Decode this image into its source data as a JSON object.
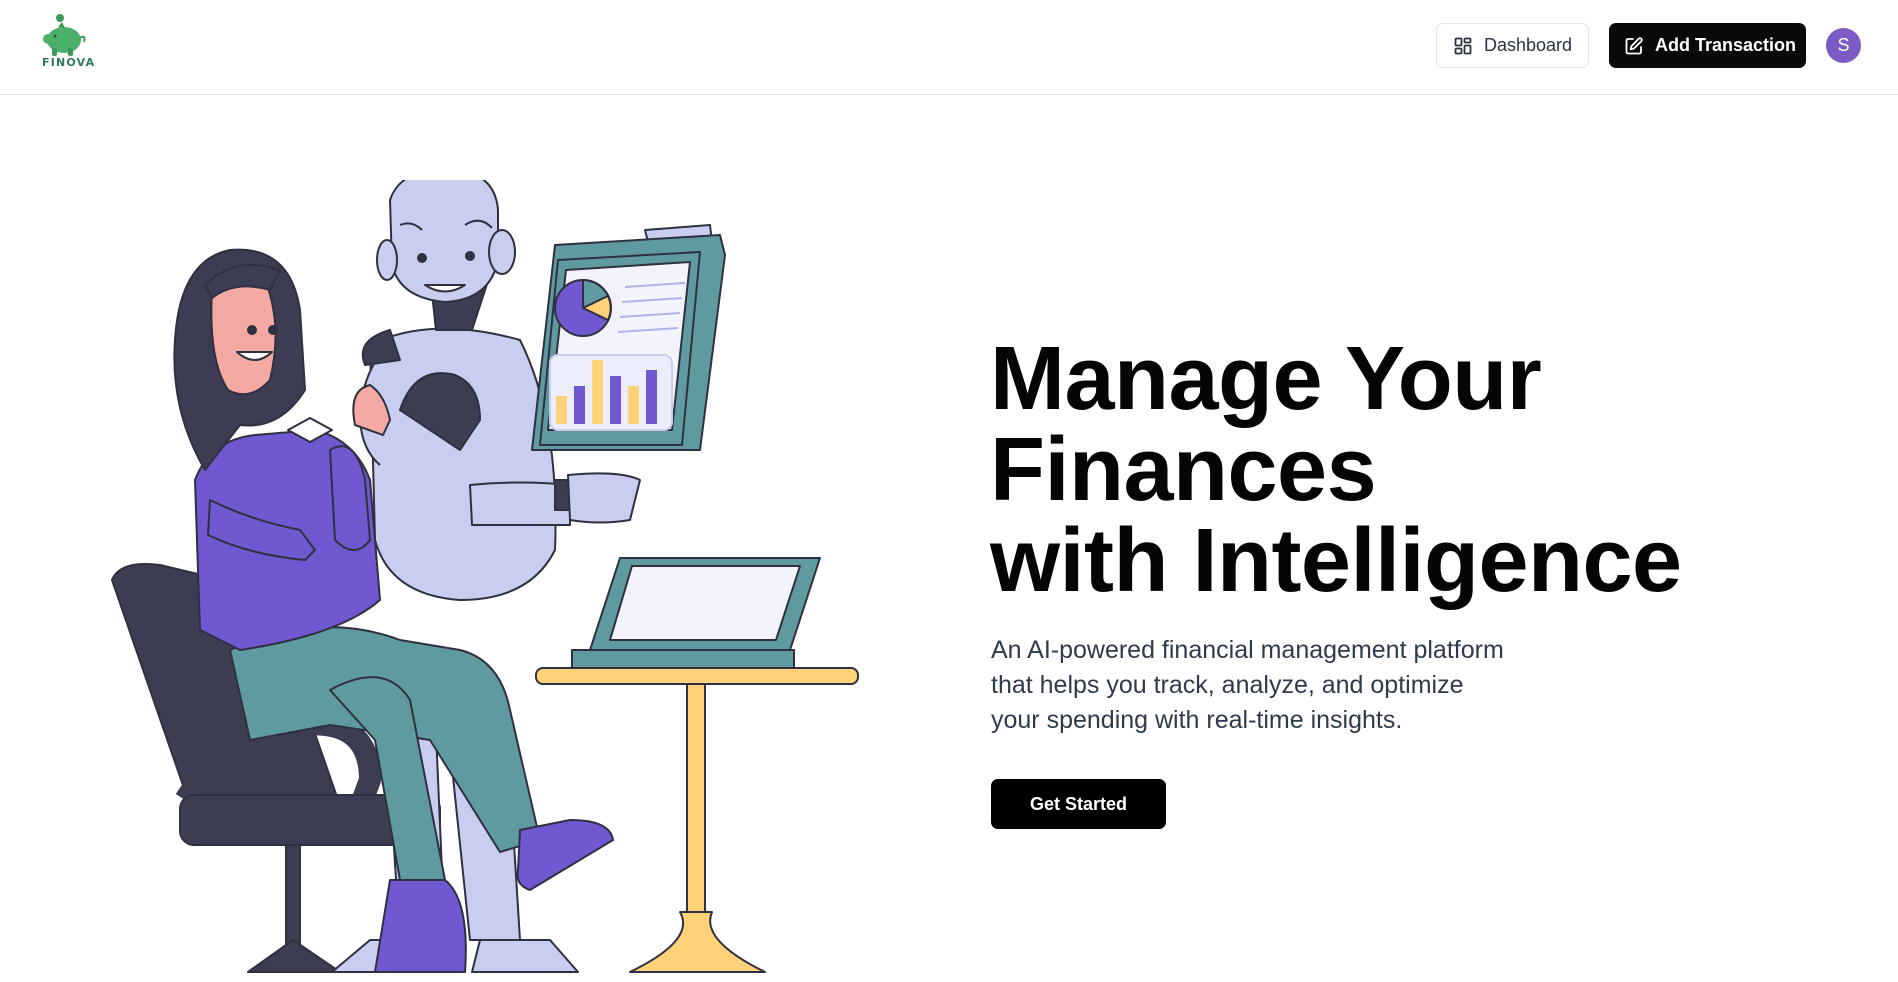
{
  "header": {
    "logo_text": "FINOVA",
    "dashboard_label": "Dashboard",
    "add_transaction_label": "Add Transaction",
    "avatar_initial": "S"
  },
  "hero": {
    "title_line1": "Manage Your",
    "title_line2": "Finances",
    "title_line3": "with Intelligence",
    "subtitle_line1": "An AI-powered financial management platform",
    "subtitle_line2": "that helps you track, analyze, and optimize",
    "subtitle_line3": "your spending with real-time insights.",
    "cta_label": "Get Started"
  },
  "colors": {
    "brand_green": "#4caf6a",
    "primary_dark": "#0a0a0a",
    "avatar_purple": "#7c5cc4",
    "illustration_purple": "#7058d0",
    "illustration_teal": "#5e9aa0",
    "illustration_yellow": "#ffd27a",
    "robot_lavender": "#c9cef0"
  },
  "icons": {
    "dashboard": "layout-grid-icon",
    "add_transaction": "pen-square-icon",
    "logo": "piggy-bank-icon"
  }
}
